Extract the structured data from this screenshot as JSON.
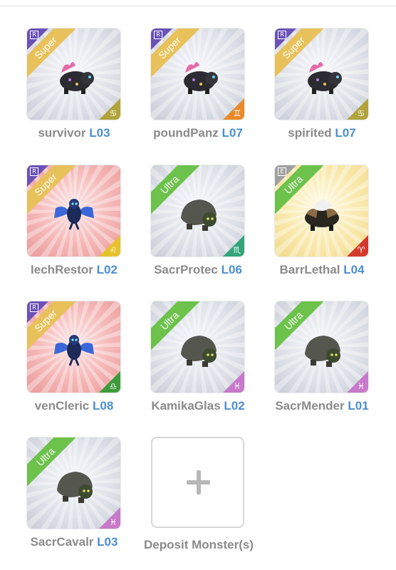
{
  "monsters": [
    {
      "name": "survivor",
      "level": "L03",
      "rarity": "Super",
      "badge": "R",
      "sign": "♋",
      "bg": "grey"
    },
    {
      "name": "poundPanz",
      "level": "L07",
      "rarity": "Super",
      "badge": "R",
      "sign": "♊",
      "bg": "grey"
    },
    {
      "name": "spirited",
      "level": "L07",
      "rarity": "Super",
      "badge": "R",
      "sign": "♋",
      "bg": "grey"
    },
    {
      "name": "lechRestor",
      "level": "L02",
      "rarity": "Super",
      "badge": "R",
      "sign": "♌",
      "bg": "red"
    },
    {
      "name": "SacrProtec",
      "level": "L06",
      "rarity": "Ultra",
      "badge": "",
      "sign": "♏",
      "bg": "grey"
    },
    {
      "name": "BarrLethal",
      "level": "L04",
      "rarity": "Ultra",
      "badge": "E",
      "sign": "♈",
      "bg": "yellow"
    },
    {
      "name": "venCleric",
      "level": "L08",
      "rarity": "Super",
      "badge": "R",
      "sign": "♎",
      "bg": "red"
    },
    {
      "name": "KamikaGlas",
      "level": "L02",
      "rarity": "Ultra",
      "badge": "",
      "sign": "♓",
      "bg": "grey"
    },
    {
      "name": "SacrMender",
      "level": "L01",
      "rarity": "Ultra",
      "badge": "",
      "sign": "♓",
      "bg": "grey"
    },
    {
      "name": "SacrCavalr",
      "level": "L03",
      "rarity": "Ultra",
      "badge": "",
      "sign": "♓",
      "bg": "grey"
    }
  ],
  "deposit": {
    "label": "Deposit Monster(s)",
    "icon": "plus-icon"
  },
  "colors": {
    "level_text": "#4a8fd1",
    "name_text": "#8a8a8a",
    "super_ribbon": "#e8c15a",
    "ultra_ribbon": "#6cc24a",
    "rare_corner": "#6a52b8"
  }
}
